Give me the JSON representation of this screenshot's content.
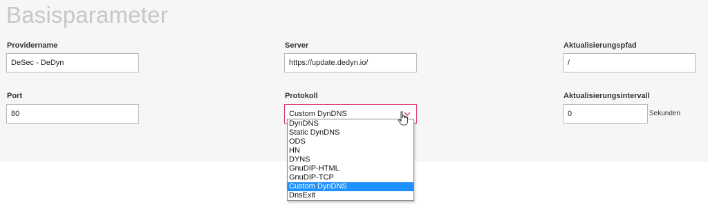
{
  "section": {
    "title": "Basisparameter"
  },
  "fields": {
    "providername": {
      "label": "Providername",
      "value": "DeSec - DeDyn"
    },
    "server": {
      "label": "Server",
      "value": "https://update.dedyn.io/"
    },
    "path": {
      "label": "Aktualisierungspfad",
      "value": "/"
    },
    "port": {
      "label": "Port",
      "value": "80"
    },
    "protocol": {
      "label": "Protokoll",
      "value": "Custom DynDNS",
      "options": [
        "DynDNS",
        "Static DynDNS",
        "ODS",
        "HN",
        "DYNS",
        "GnuDIP-HTML",
        "GnuDIP-TCP",
        "Custom DynDNS",
        "DnsExit"
      ],
      "selected_index": 7
    },
    "interval": {
      "label": "Aktualisierungsintervall",
      "value": "0",
      "unit": "Sekunden"
    }
  },
  "colors": {
    "panel": "#f6f6f6",
    "focus_border": "#d6336c",
    "option_highlight": "#1e90ff"
  },
  "icons": {
    "select_arrow": "chevron-down-icon",
    "pointer": "hand-cursor-icon"
  }
}
